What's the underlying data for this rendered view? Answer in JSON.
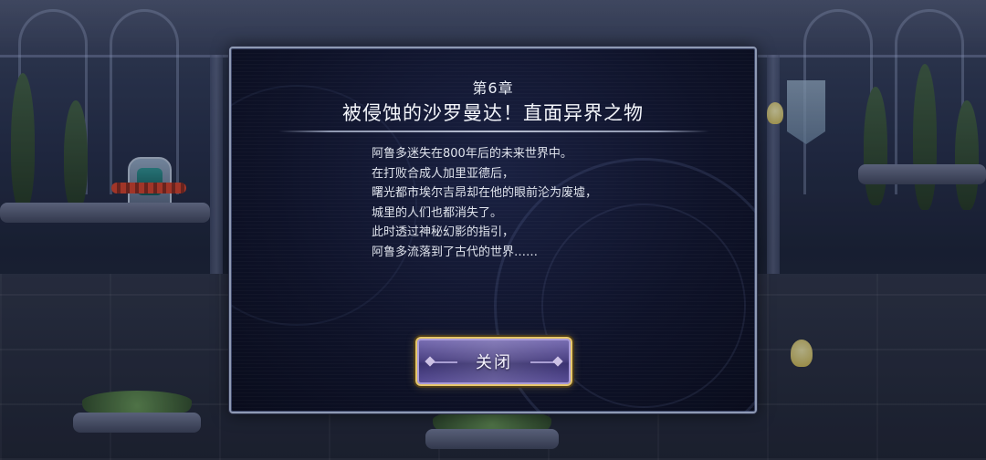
{
  "dialog": {
    "chapter": "第6章",
    "title": "被侵蚀的沙罗曼达！直面异界之物",
    "story_lines": [
      "阿鲁多迷失在800年后的未来世界中。",
      "在打败合成人加里亚德后，",
      "曙光都市埃尔吉昂却在他的眼前沦为废墟，",
      "城里的人们也都消失了。",
      "此时透过神秘幻影的指引，",
      "阿鲁多流落到了古代的世界……"
    ],
    "close_button": "关闭"
  },
  "colors": {
    "dialog_border": "#8f9ab4",
    "dialog_bg": "#0e1228",
    "button_gold": "#e7c76a",
    "button_purple": "#4e4486",
    "text": "#f4f6fb"
  },
  "icons": [
    "emblem-decoration",
    "button-diamond-ornament"
  ]
}
